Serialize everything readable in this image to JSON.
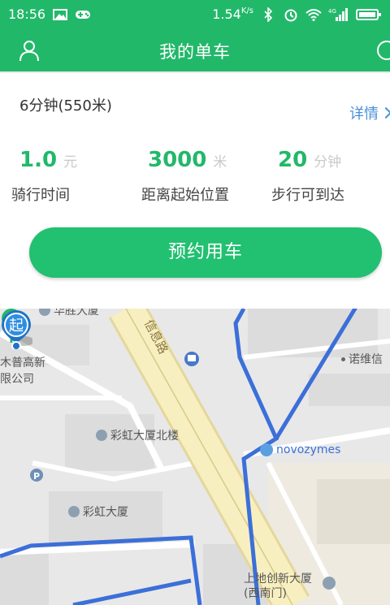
{
  "status": {
    "time": "18:56",
    "speed": "1.54",
    "speed_unit": "K/s",
    "network": "4G"
  },
  "header": {
    "title": "我的单车"
  },
  "card": {
    "route": "6分钟(550米)",
    "detail": "详情",
    "stats": [
      {
        "value": "1.0",
        "unit": "元",
        "label": "骑行时间"
      },
      {
        "value": "3000",
        "unit": "米",
        "label": "距离起始位置"
      },
      {
        "value": "20",
        "unit": "分钟",
        "label": "步行可到达"
      }
    ],
    "reserve_button": "预约用车"
  },
  "map": {
    "pois": {
      "p1": "华胜大厦",
      "p2": "信息路",
      "p3": "诺维信",
      "p4": "木普高新",
      "p5": "限公司",
      "p6": "彩虹大厦北楼",
      "p7": "novozymes",
      "p8": "彩虹大厦",
      "p9": "上地创新大厦",
      "p10": "(西南门)"
    },
    "start_marker": "起",
    "parking_symbol": "P"
  },
  "colors": {
    "brand": "#22b86a",
    "link": "#4a90d9",
    "route": "#3c6fd8",
    "road": "#f6e9a7"
  }
}
